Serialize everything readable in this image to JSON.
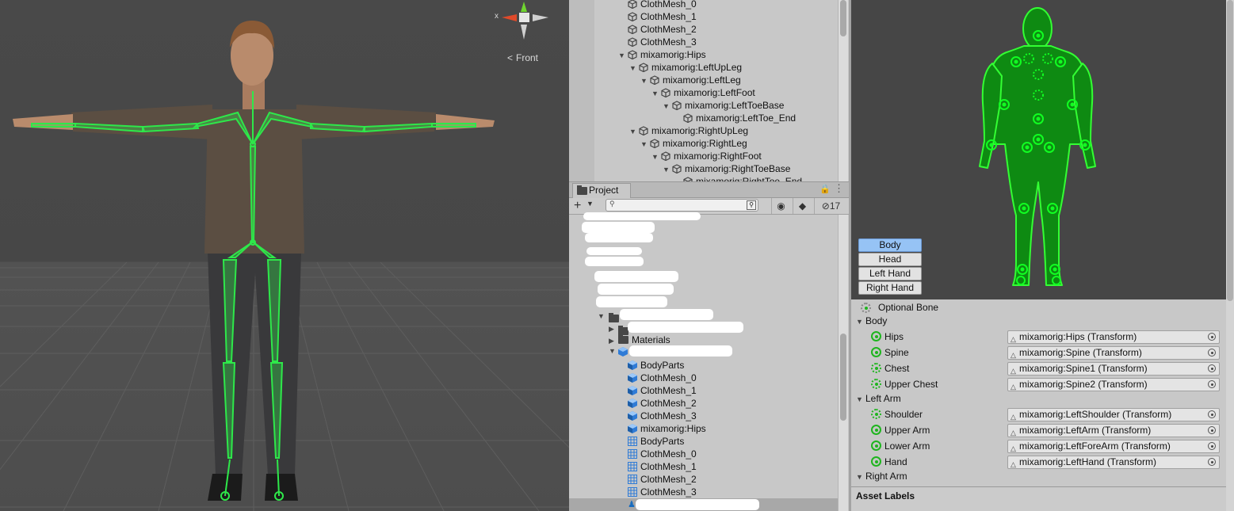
{
  "scene": {
    "gizmo_x_label": "x",
    "gizmo_view_label": "Front",
    "colors": {
      "bone": "#2ee84a",
      "skin": "#b88a6a",
      "shirt": "#5a4d40",
      "jeans": "#3a3a3c"
    }
  },
  "hierarchy": {
    "rows": [
      {
        "label": "ClothMesh_0",
        "indent": 0,
        "expanded": null
      },
      {
        "label": "ClothMesh_1",
        "indent": 0,
        "expanded": null
      },
      {
        "label": "ClothMesh_2",
        "indent": 0,
        "expanded": null
      },
      {
        "label": "ClothMesh_3",
        "indent": 0,
        "expanded": null
      },
      {
        "label": "mixamorig:Hips",
        "indent": 0,
        "expanded": true
      },
      {
        "label": "mixamorig:LeftUpLeg",
        "indent": 1,
        "expanded": true
      },
      {
        "label": "mixamorig:LeftLeg",
        "indent": 2,
        "expanded": true
      },
      {
        "label": "mixamorig:LeftFoot",
        "indent": 3,
        "expanded": true
      },
      {
        "label": "mixamorig:LeftToeBase",
        "indent": 4,
        "expanded": true
      },
      {
        "label": "mixamorig:LeftToe_End",
        "indent": 5,
        "expanded": null
      },
      {
        "label": "mixamorig:RightUpLeg",
        "indent": 1,
        "expanded": true
      },
      {
        "label": "mixamorig:RightLeg",
        "indent": 2,
        "expanded": true
      },
      {
        "label": "mixamorig:RightFoot",
        "indent": 3,
        "expanded": true
      },
      {
        "label": "mixamorig:RightToeBase",
        "indent": 4,
        "expanded": true
      },
      {
        "label": "mixamorig:RightToe_End",
        "indent": 5,
        "expanded": null
      }
    ]
  },
  "project": {
    "tab_label": "Project",
    "add_label": "+",
    "search_placeholder": "",
    "hidden_count": "17",
    "materials_folder": "Materials",
    "assets": [
      {
        "label": "BodyParts",
        "kind": "mesh-object"
      },
      {
        "label": "ClothMesh_0",
        "kind": "mesh-object"
      },
      {
        "label": "ClothMesh_1",
        "kind": "mesh-object"
      },
      {
        "label": "ClothMesh_2",
        "kind": "mesh-object"
      },
      {
        "label": "ClothMesh_3",
        "kind": "mesh-object"
      },
      {
        "label": "mixamorig:Hips",
        "kind": "mesh-object"
      },
      {
        "label": "BodyParts",
        "kind": "mesh-grid"
      },
      {
        "label": "ClothMesh_0",
        "kind": "mesh-grid"
      },
      {
        "label": "ClothMesh_1",
        "kind": "mesh-grid"
      },
      {
        "label": "ClothMesh_2",
        "kind": "mesh-grid"
      },
      {
        "label": "ClothMesh_3",
        "kind": "mesh-grid"
      }
    ]
  },
  "avatar": {
    "parts": [
      {
        "label": "Body",
        "active": true
      },
      {
        "label": "Head",
        "active": false
      },
      {
        "label": "Left Hand",
        "active": false
      },
      {
        "label": "Right Hand",
        "active": false
      }
    ],
    "optional_bone_label": "Optional Bone",
    "groups": [
      {
        "label": "Body",
        "bones": [
          {
            "name": "Hips",
            "value": "mixamorig:Hips (Transform)",
            "optional": false
          },
          {
            "name": "Spine",
            "value": "mixamorig:Spine (Transform)",
            "optional": false
          },
          {
            "name": "Chest",
            "value": "mixamorig:Spine1 (Transform)",
            "optional": true
          },
          {
            "name": "Upper Chest",
            "value": "mixamorig:Spine2 (Transform)",
            "optional": true
          }
        ]
      },
      {
        "label": "Left Arm",
        "bones": [
          {
            "name": "Shoulder",
            "value": "mixamorig:LeftShoulder (Transform)",
            "optional": true
          },
          {
            "name": "Upper Arm",
            "value": "mixamorig:LeftArm (Transform)",
            "optional": false
          },
          {
            "name": "Lower Arm",
            "value": "mixamorig:LeftForeArm (Transform)",
            "optional": false
          },
          {
            "name": "Hand",
            "value": "mixamorig:LeftHand (Transform)",
            "optional": false
          }
        ]
      },
      {
        "label": "Right Arm",
        "bones": []
      }
    ],
    "asset_labels": "Asset Labels"
  }
}
